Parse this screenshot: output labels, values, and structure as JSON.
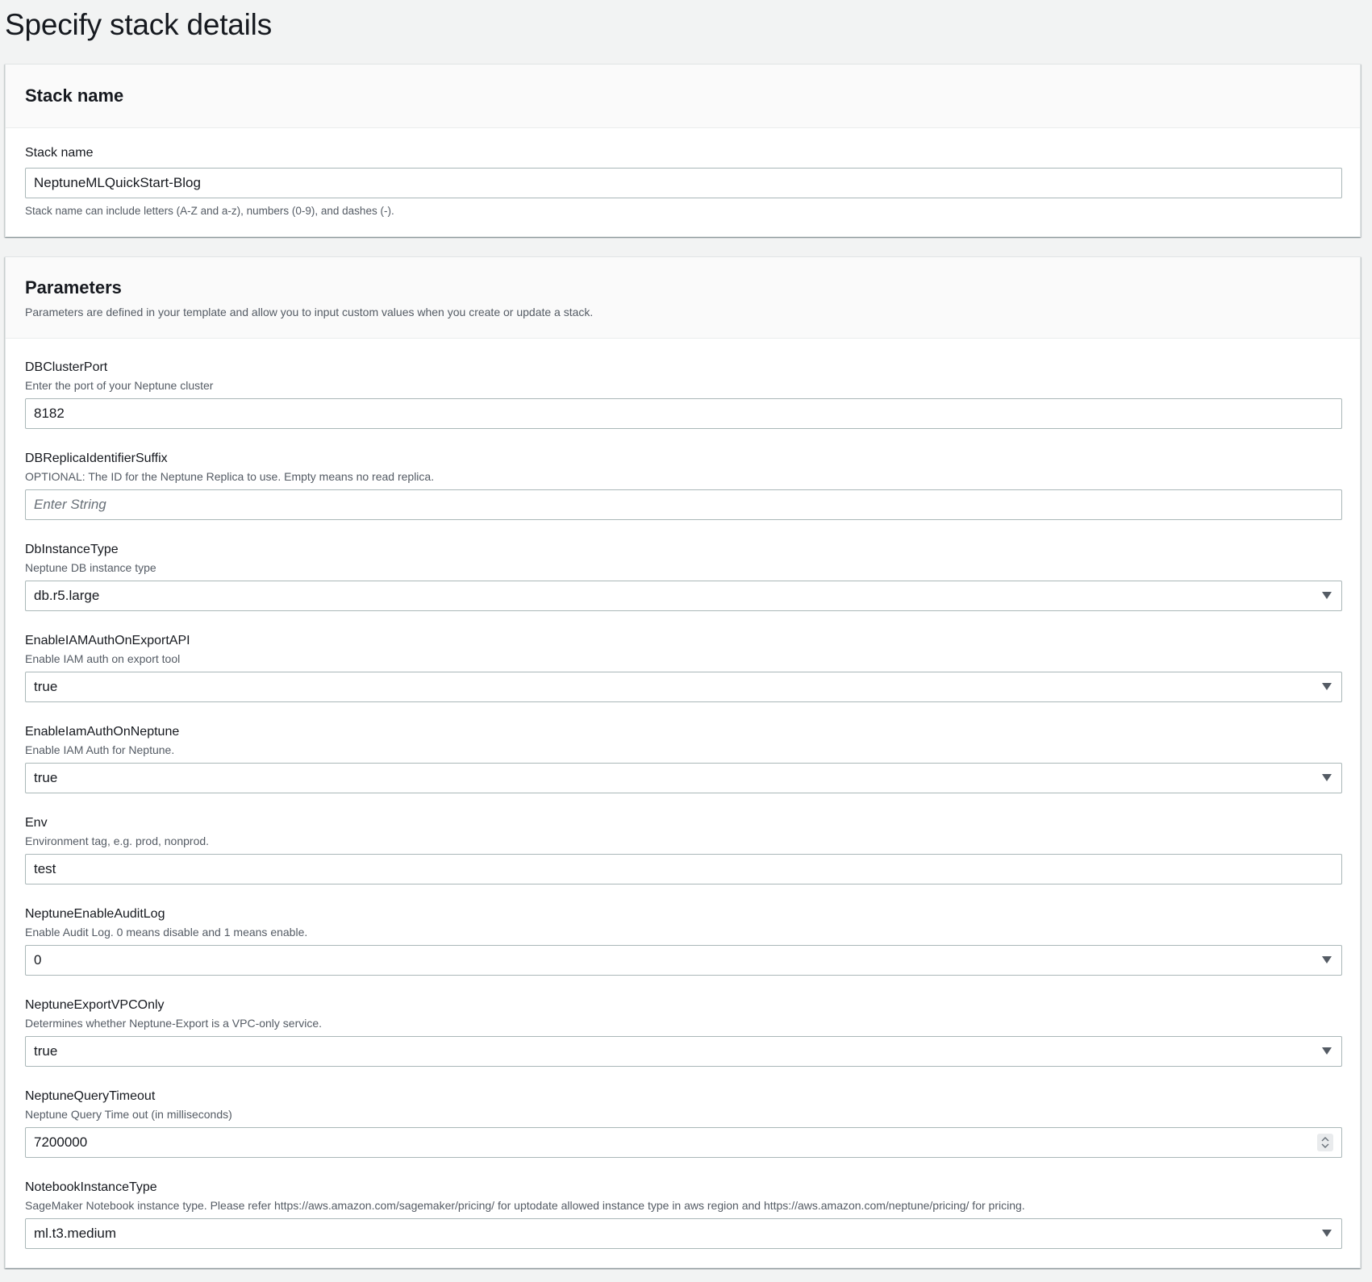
{
  "page": {
    "title": "Specify stack details"
  },
  "stack_section": {
    "header": "Stack name",
    "field_label": "Stack name",
    "value": "NeptuneMLQuickStart-Blog",
    "constraint": "Stack name can include letters (A-Z and a-z), numbers (0-9), and dashes (-)."
  },
  "params_section": {
    "header": "Parameters",
    "description": "Parameters are defined in your template and allow you to input custom values when you create or update a stack.",
    "params": [
      {
        "label": "DBClusterPort",
        "desc": "Enter the port of your Neptune cluster",
        "value": "8182",
        "control": "text"
      },
      {
        "label": "DBReplicaIdentifierSuffix",
        "desc": "OPTIONAL: The ID for the Neptune Replica to use. Empty means no read replica.",
        "value": "",
        "placeholder": "Enter String",
        "control": "text"
      },
      {
        "label": "DbInstanceType",
        "desc": "Neptune DB instance type",
        "value": "db.r5.large",
        "control": "select"
      },
      {
        "label": "EnableIAMAuthOnExportAPI",
        "desc": "Enable IAM auth on export tool",
        "value": "true",
        "control": "select"
      },
      {
        "label": "EnableIamAuthOnNeptune",
        "desc": "Enable IAM Auth for Neptune.",
        "value": "true",
        "control": "select"
      },
      {
        "label": "Env",
        "desc": "Environment tag, e.g. prod, nonprod.",
        "value": "test",
        "control": "text"
      },
      {
        "label": "NeptuneEnableAuditLog",
        "desc": "Enable Audit Log. 0 means disable and 1 means enable.",
        "value": "0",
        "control": "select"
      },
      {
        "label": "NeptuneExportVPCOnly",
        "desc": "Determines whether Neptune-Export is a VPC-only service.",
        "value": "true",
        "control": "select"
      },
      {
        "label": "NeptuneQueryTimeout",
        "desc": "Neptune Query Time out (in milliseconds)",
        "value": "7200000",
        "control": "number"
      },
      {
        "label": "NotebookInstanceType",
        "desc": "SageMaker Notebook instance type. Please refer https://aws.amazon.com/sagemaker/pricing/ for uptodate allowed instance type in aws region and https://aws.amazon.com/neptune/pricing/ for pricing.",
        "value": "ml.t3.medium",
        "control": "select"
      }
    ]
  },
  "icons": {
    "select_caret": "caret-down-icon",
    "number_spinner": "spinner-icon"
  }
}
